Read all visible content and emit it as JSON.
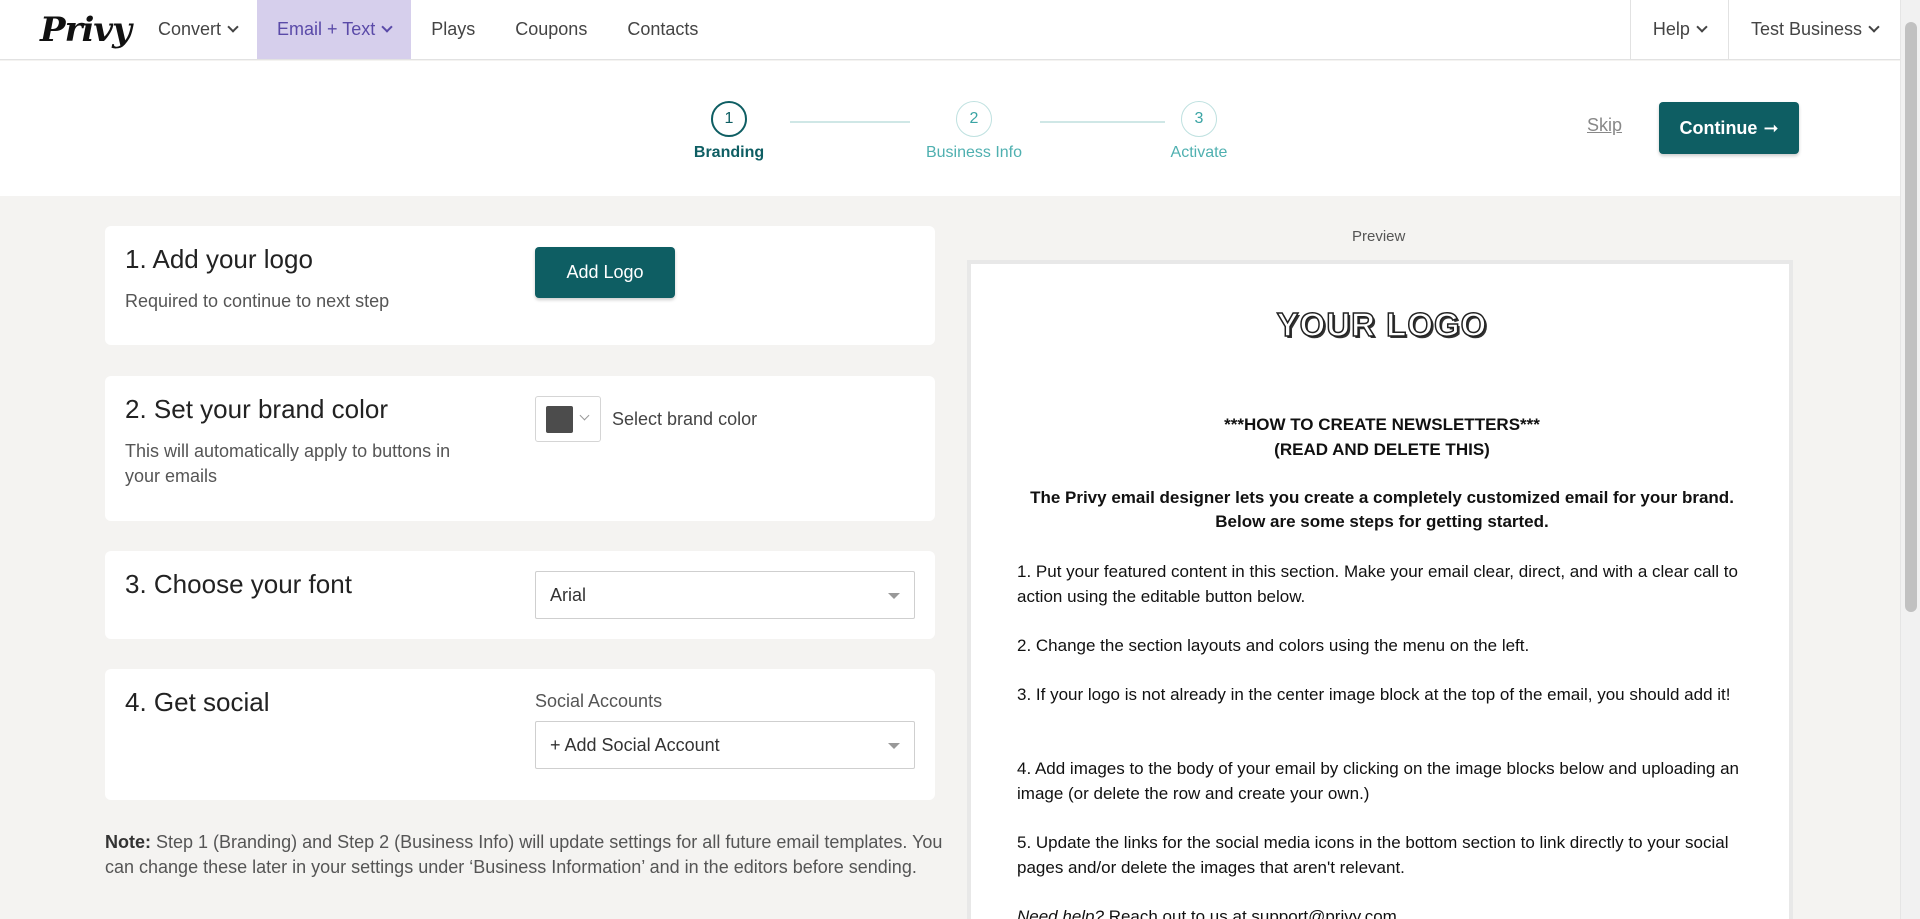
{
  "nav": {
    "logo": "Privy",
    "items": [
      "Convert",
      "Email + Text",
      "Plays",
      "Coupons",
      "Contacts"
    ],
    "right": [
      "Help",
      "Test Business"
    ]
  },
  "stepper": {
    "steps": [
      {
        "num": "1",
        "label": "Branding"
      },
      {
        "num": "2",
        "label": "Business Info"
      },
      {
        "num": "3",
        "label": "Activate"
      }
    ],
    "skip": "Skip",
    "continue": "Continue",
    "continue_arrow": "➞"
  },
  "cards": {
    "logo": {
      "title": "1. Add your logo",
      "sub": "Required to continue to next step",
      "button": "Add Logo"
    },
    "color": {
      "title": "2. Set your brand color",
      "sub": "This will automatically apply to buttons in your emails",
      "label": "Select brand color",
      "swatch": "#4c4c4c"
    },
    "font": {
      "title": "3. Choose your font",
      "value": "Arial"
    },
    "social": {
      "title": "4. Get social",
      "field_label": "Social Accounts",
      "value": "+ Add Social Account"
    }
  },
  "note": {
    "bold": "Note:",
    "text": " Step 1 (Branding) and Step 2 (Business Info) will update settings for all future email templates. You can change these later in your settings under ‘Business Information’ and in the editors before sending."
  },
  "preview": {
    "label": "Preview",
    "logo": "YOUR LOGO",
    "head1": "***HOW TO CREATE NEWSLETTERS***",
    "head2": "(READ AND DELETE THIS)",
    "intro": "The Privy email designer lets you create a completely customized email for your brand. Below are some steps for getting started.",
    "steps": [
      "1. Put your featured content in this section. Make your email clear, direct, and with a clear call to action using the editable button below.",
      "2. Change the section layouts and colors using the menu on the left.",
      "3. If your logo is not already in the center image block at the top of the email, you should add it!",
      "4. Add images to the body of your email by clicking on the image blocks below and uploading an image (or delete the row and create your own.)",
      "5. Update the links for the social media icons in the bottom section to link directly to your social pages and/or delete the images that aren't relevant."
    ],
    "help_italic": "Need help?",
    "help_text": " Reach out to us at support@privy.com"
  },
  "colors": {
    "accent": "#0e5e63",
    "nav_active_bg": "#d6cfec",
    "nav_active_text": "#5a4aa8",
    "step_inactive": "#4fb0b0"
  }
}
